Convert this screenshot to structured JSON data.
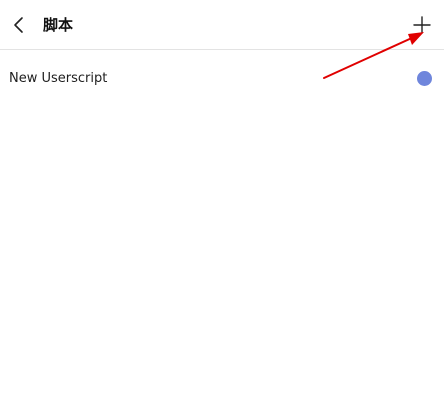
{
  "header": {
    "back_icon": "chevron-left-icon",
    "title": "脚本",
    "add_icon": "plus-icon"
  },
  "scripts": [
    {
      "name": "New Userscript",
      "status_color": "#6f86dc"
    }
  ],
  "annotation": {
    "color": "#e00000",
    "icon": "red-arrow"
  }
}
